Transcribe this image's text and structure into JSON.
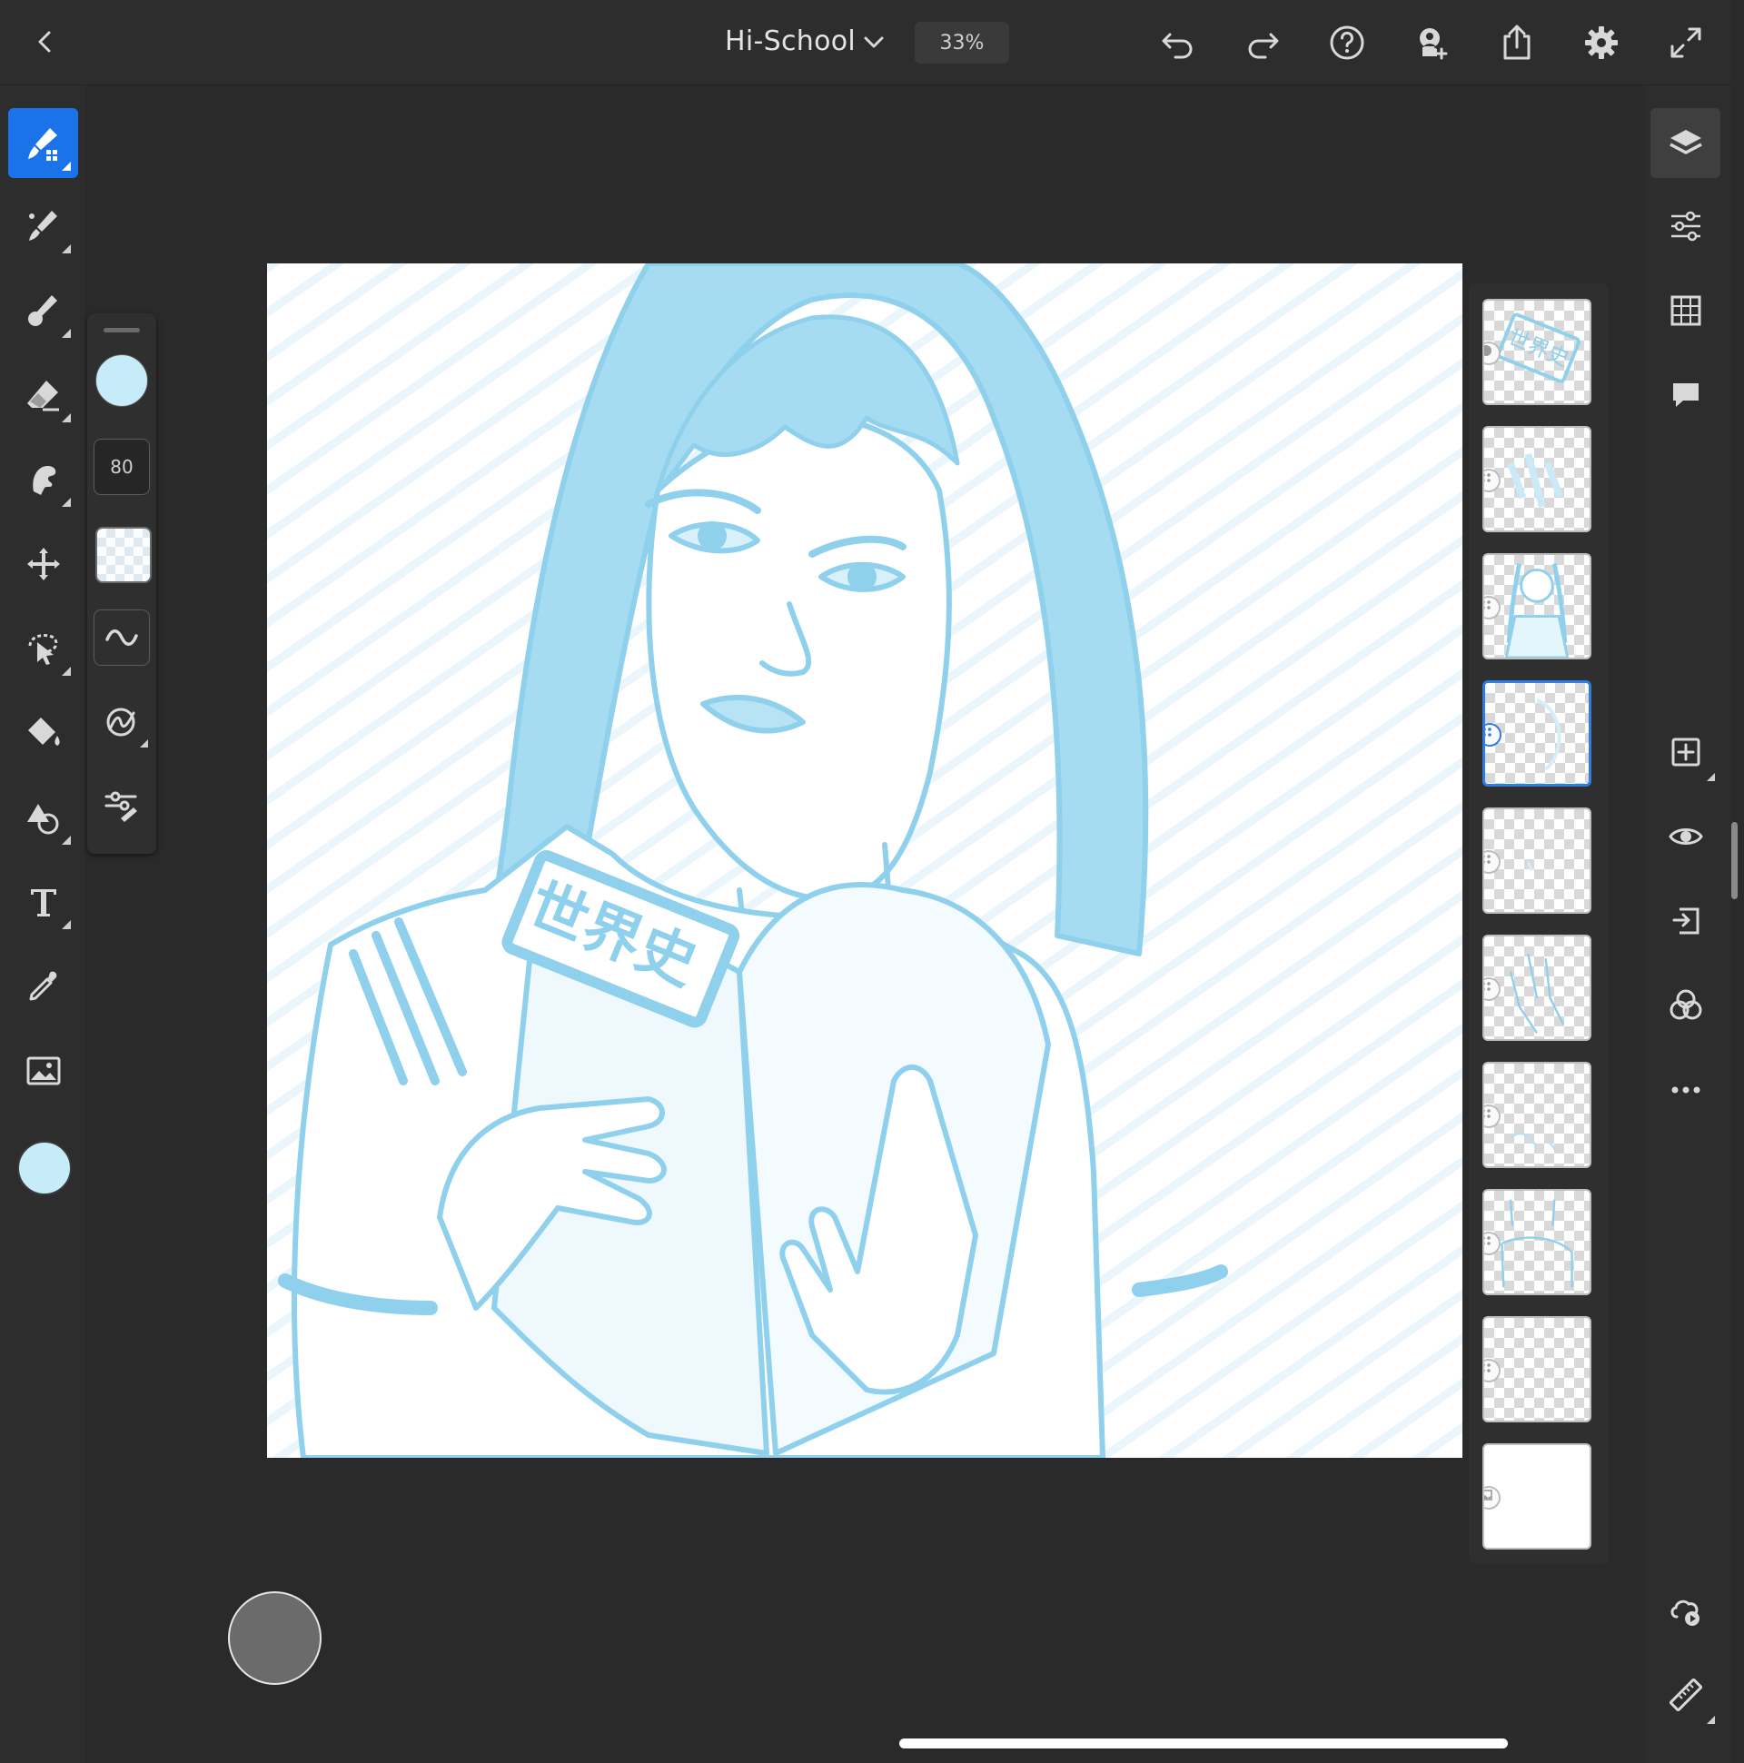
{
  "topbar": {
    "back": "back-chevron",
    "title": "Hi-School",
    "zoom": "33%",
    "icons": [
      "undo-icon",
      "redo-icon",
      "help-icon",
      "invite-icon",
      "share-icon",
      "settings-icon",
      "fullscreen-icon"
    ]
  },
  "tools": [
    "pixel-brush",
    "live-brush",
    "vector-brush",
    "eraser",
    "smudge",
    "transform",
    "selection",
    "fill",
    "shape",
    "text",
    "eyedropper",
    "image"
  ],
  "brush": {
    "size": "80",
    "color": "#c6ecfa"
  },
  "canvas": {
    "book_title": "世界史",
    "ink_color": "#8fd0ec"
  },
  "layers": {
    "selected_index": 3,
    "thumb_label": "世界史",
    "count": 10
  },
  "colors": {
    "accent": "#1a73e8",
    "panel": "#2d2d2d",
    "background": "#2a2a2a"
  }
}
